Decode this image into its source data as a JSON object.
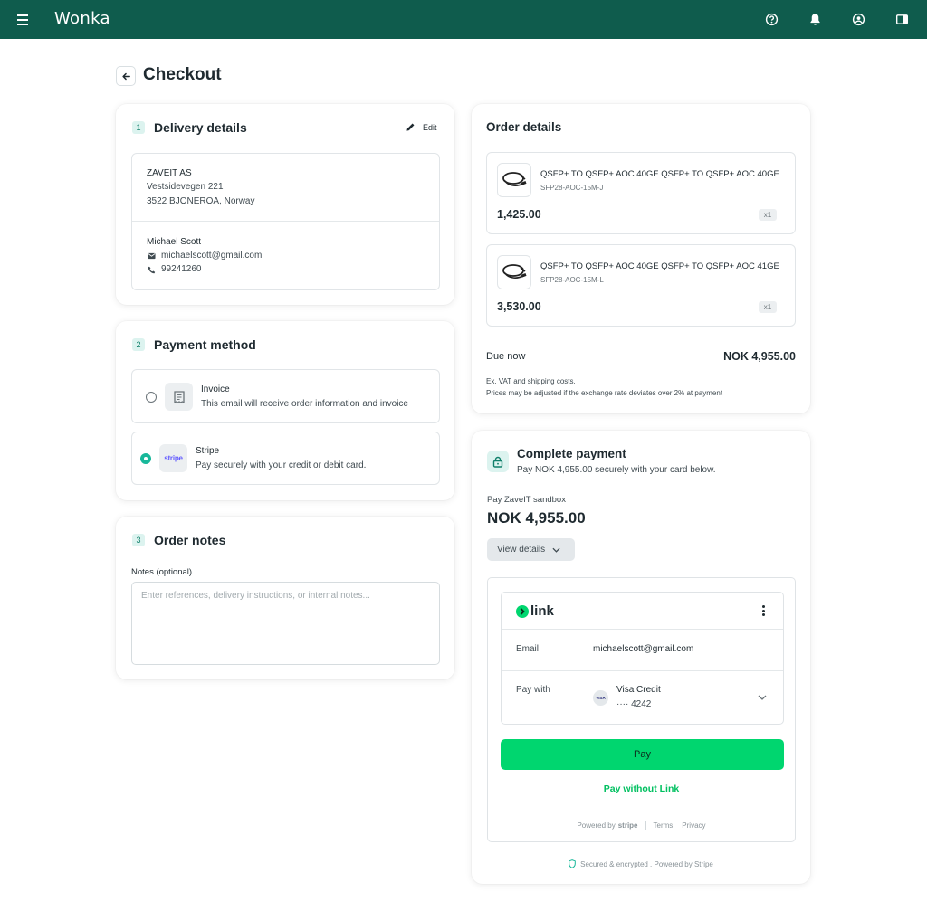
{
  "app": {
    "title": "Wonka"
  },
  "page": {
    "title": "Checkout"
  },
  "delivery": {
    "step": "1",
    "title": "Delivery details",
    "edit_label": "Edit",
    "company": "ZAVEIT AS",
    "street": "Vestsidevegen 221",
    "postal": "3522 BJONEROA, Norway",
    "contact_name": "Michael Scott",
    "email": "michaelscott@gmail.com",
    "phone": "99241260"
  },
  "payment_method": {
    "step": "2",
    "title": "Payment method",
    "options": [
      {
        "label": "Invoice",
        "description": "This email will receive order information and invoice",
        "selected": false
      },
      {
        "label": "Stripe",
        "description": "Pay securely with your credit or debit card.",
        "selected": true,
        "logo_text": "stripe"
      }
    ]
  },
  "order_notes": {
    "step": "3",
    "title": "Order notes",
    "label": "Notes (optional)",
    "placeholder": "Enter references, delivery instructions, or internal notes..."
  },
  "order_details": {
    "title": "Order details",
    "items": [
      {
        "name": "QSFP+ TO QSFP+ AOC 40GE QSFP+ TO QSFP+ AOC 40GE",
        "sku": "SFP28-AOC-15M-J",
        "price": "1,425.00",
        "qty": "x1"
      },
      {
        "name": "QSFP+ TO QSFP+ AOC 40GE QSFP+ TO QSFP+ AOC 41GE",
        "sku": "SFP28-AOC-15M-L",
        "price": "3,530.00",
        "qty": "x1"
      }
    ],
    "due_label": "Due now",
    "due_amount": "NOK 4,955.00",
    "note_1": "Ex. VAT and shipping costs.",
    "note_2": "Prices may be adjusted if the exchange rate deviates over 2% at payment"
  },
  "complete_payment": {
    "title": "Complete payment",
    "subtitle": "Pay NOK 4,955.00 securely with your card below.",
    "merchant": "Pay ZaveIT sandbox",
    "amount": "NOK 4,955.00",
    "view_details": "View details",
    "link_logo": "link",
    "email_label": "Email",
    "email_value": "michaelscott@gmail.com",
    "pay_with_label": "Pay with",
    "card_brand": "VISA",
    "card_name": "Visa Credit",
    "card_last4": "···· 4242",
    "pay_button": "Pay",
    "pay_without_link": "Pay without Link",
    "powered_by": "Powered by",
    "stripe_word": "stripe",
    "terms": "Terms",
    "privacy": "Privacy",
    "secured": "Secured & encrypted . Powered by Stripe"
  },
  "colors": {
    "header": "#0f5c4d",
    "accent": "#18b89a",
    "link_green": "#00d66f"
  }
}
